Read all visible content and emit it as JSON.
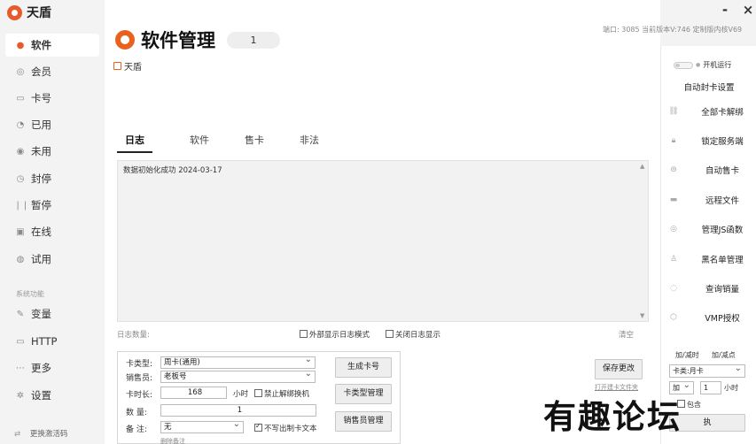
{
  "app": {
    "name": "天盾",
    "minimize": "-",
    "close": "×"
  },
  "sidebar": {
    "items": [
      {
        "label": "软件",
        "icon": "software-icon"
      },
      {
        "label": "会员",
        "icon": "member-icon"
      },
      {
        "label": "卡号",
        "icon": "card-icon"
      },
      {
        "label": "已用",
        "icon": "used-icon"
      },
      {
        "label": "未用",
        "icon": "unused-icon"
      },
      {
        "label": "封停",
        "icon": "ban-icon"
      },
      {
        "label": "暂停",
        "icon": "pause-icon"
      },
      {
        "label": "在线",
        "icon": "monitor-icon"
      },
      {
        "label": "试用",
        "icon": "trial-icon"
      }
    ],
    "section_label": "系统功能",
    "system_items": [
      {
        "label": "变量",
        "icon": "edit-icon"
      },
      {
        "label": "HTTP",
        "icon": "screen-icon"
      },
      {
        "label": "更多",
        "icon": "more-icon"
      },
      {
        "label": "设置",
        "icon": "gear-icon"
      }
    ],
    "bottom_label": "更换激活码"
  },
  "header": {
    "title": "软件管理",
    "badge": "1",
    "version_info": "端口: 3085  当前版本V:746 定制版内核V69",
    "brand": "天盾"
  },
  "tabs": [
    "日志",
    "软件",
    "售卡",
    "非法"
  ],
  "log": {
    "lines": [
      "数据初始化成功  2024-03-17"
    ],
    "count_label": "日志数量:",
    "external_label": "外部显示日志模式",
    "close_label": "关闭日志显示",
    "clear_label": "清空"
  },
  "card_form": {
    "type_label": "卡类型:",
    "type_value": "周卡(通用)",
    "seller_label": "销售员:",
    "seller_value": "老板号",
    "duration_label": "卡时长:",
    "duration_value": "168",
    "hour_label": "小时",
    "no_unbind_label": "禁止解绑换机",
    "qty_label": "数    量:",
    "qty_value": "1",
    "note_label": "备    注:",
    "note_value": "无",
    "no_write_label": "不写出制卡文本",
    "delete_link": "删除备注",
    "gen_button": "生成卡号",
    "type_mgmt_button": "卡类型管理",
    "seller_mgmt_button": "销售员管理",
    "save_button": "保存更改",
    "open_dir_link": "打开建卡文件夹"
  },
  "right_panel": {
    "boot_label": "开机运行",
    "auto_ban": "自动封卡设置",
    "items": [
      {
        "label": "全部卡解绑",
        "icon": "link-icon"
      },
      {
        "label": "锁定服务端",
        "icon": "lock-icon"
      },
      {
        "label": "自动售卡",
        "icon": "dollar-icon"
      },
      {
        "label": "远程文件",
        "icon": "folder-icon"
      },
      {
        "label": "管理JS函数",
        "icon": "script-icon"
      },
      {
        "label": "黑名单管理",
        "icon": "user-icon"
      },
      {
        "label": "查询销量",
        "icon": "search-icon"
      },
      {
        "label": "VMP授权",
        "icon": "shield-icon"
      }
    ],
    "add_time_label": "加/减时",
    "add_points_label": "加/减点",
    "card_select": "卡类:月卡",
    "op_select": "加",
    "op_value": "1",
    "op_unit": "小时",
    "include_label": "包含",
    "exec_button": "执"
  },
  "watermark": "有趣论坛",
  "colors": {
    "accent": "#e8621f",
    "background": "#f3f3f3",
    "panel": "#ffffff"
  }
}
